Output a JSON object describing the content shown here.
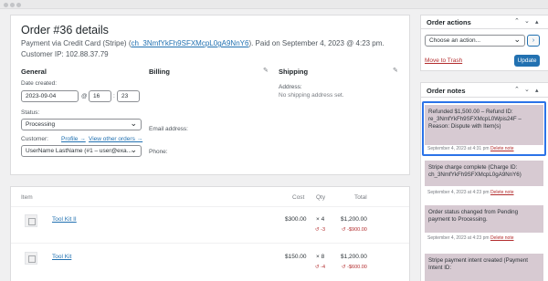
{
  "order": {
    "title": "Order #36 details",
    "payment_prefix": "Payment via Credit Card (Stripe) (",
    "payment_id": "ch_3NmfYkFh9SFXMcpL0gA9NnY6",
    "payment_suffix": "). Paid on September 4, 2023 @ 4:23 pm.",
    "customer_ip": "Customer IP: 102.88.37.79"
  },
  "general": {
    "heading": "General",
    "date_label": "Date created:",
    "date_value": "2023-09-04",
    "at": "@",
    "hour": "16",
    "minute": "23",
    "status_label": "Status:",
    "status_value": "Processing",
    "customer_label": "Customer:",
    "profile_link": "Profile →",
    "other_orders_link": "View other orders →",
    "customer_value": "UserName LastName (#1 – user@exa..."
  },
  "billing": {
    "heading": "Billing",
    "email_label": "Email address:",
    "phone_label": "Phone:"
  },
  "shipping": {
    "heading": "Shipping",
    "address_label": "Address:",
    "address_value": "No shipping address set."
  },
  "items": {
    "headers": {
      "item": "Item",
      "cost": "Cost",
      "qty": "Qty",
      "total": "Total"
    },
    "rows": [
      {
        "name": "Tool Kit II",
        "cost": "$300.00",
        "qty": "× 4",
        "refund_qty": "-3",
        "total": "$1,200.00",
        "refund_total": "-$900.00"
      },
      {
        "name": "Tool Kit",
        "cost": "$150.00",
        "qty": "× 8",
        "refund_qty": "-4",
        "total": "$1,200.00",
        "refund_total": "-$600.00"
      }
    ]
  },
  "actions": {
    "title": "Order actions",
    "select_placeholder": "Choose an action...",
    "go": "›",
    "trash": "Move to Trash",
    "update": "Update"
  },
  "notes": {
    "title": "Order notes",
    "list": [
      {
        "text": "Refunded $1,500.00 – Refund ID: re_3NmfYkFh9SFXMcpL0Wpis24F – Reason: Dispute with Item(s)",
        "date": "September 4, 2023 at 4:31 pm",
        "delete": "Delete note"
      },
      {
        "text": "Stripe charge complete (Charge ID: ch_3NmfYkFh9SFXMcpL0gA9NnY6)",
        "date": "September 4, 2023 at 4:23 pm",
        "delete": "Delete note"
      },
      {
        "text": "Order status changed from Pending payment to Processing.",
        "date": "September 4, 2023 at 4:23 pm",
        "delete": "Delete note"
      },
      {
        "text": "Stripe payment intent created (Payment Intent ID:",
        "date": "",
        "delete": ""
      }
    ]
  }
}
